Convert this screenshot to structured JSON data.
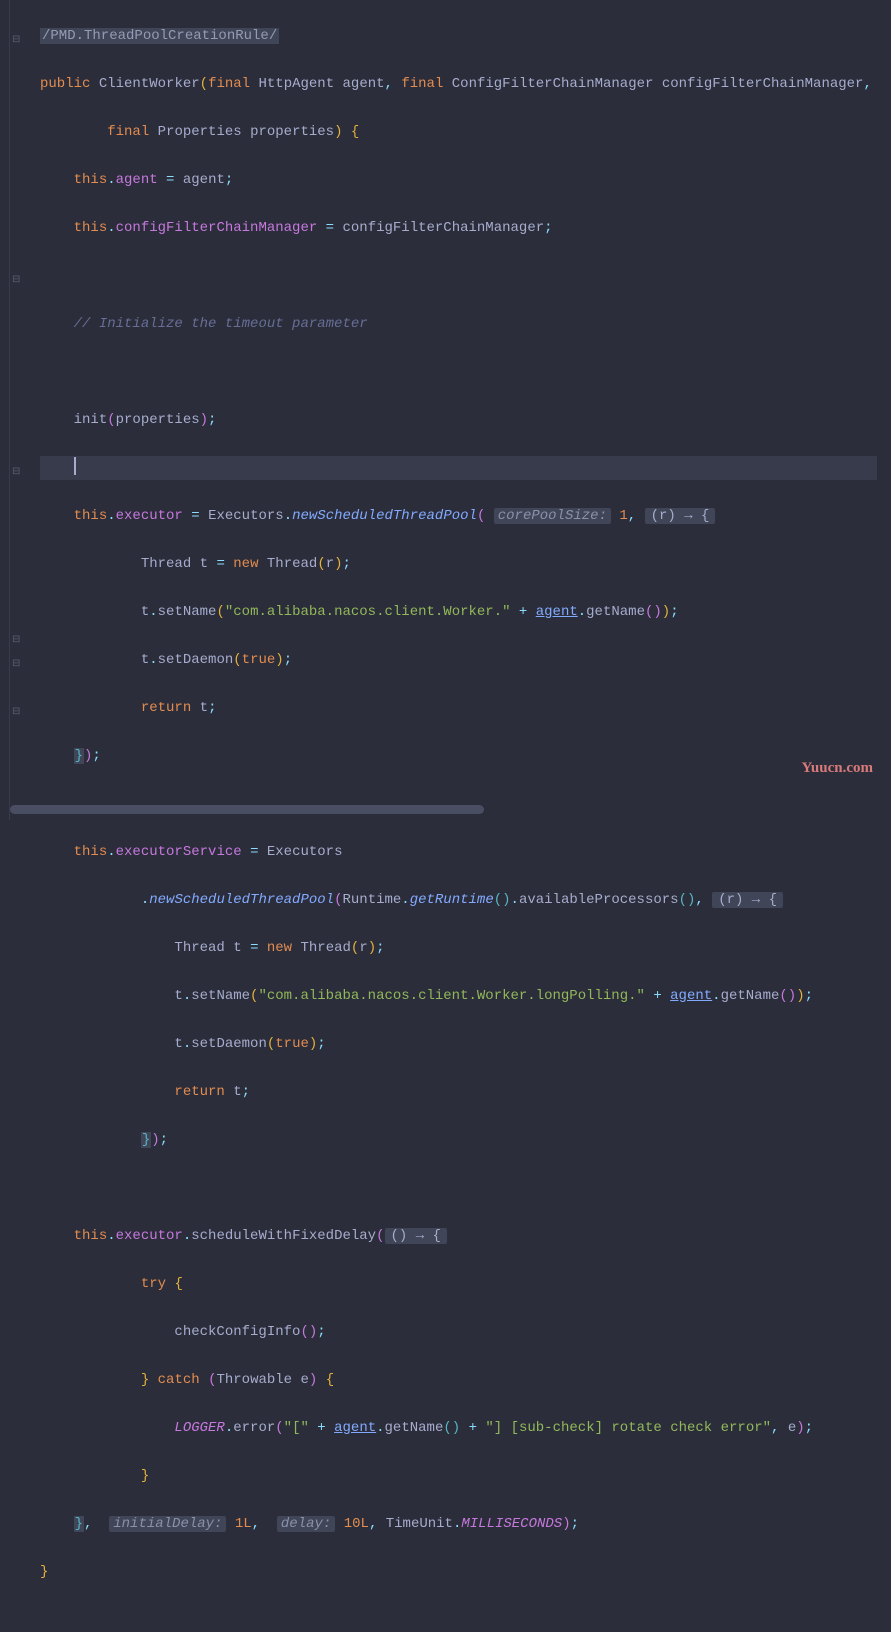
{
  "annotation": "/PMD.ThreadPoolCreationRule/",
  "watermark": "Yuucn.com",
  "t": {
    "public": "public",
    "final": "final",
    "this": "this",
    "new": "new",
    "return": "return",
    "try": "try",
    "catch": "catch",
    "true": "true",
    "ClientWorker": "ClientWorker",
    "HttpAgent": "HttpAgent",
    "agent": "agent",
    "ConfigFilterChainManager": "ConfigFilterChainManager",
    "configFilterChainManager": "configFilterChainManager",
    "Properties": "Properties",
    "properties": "properties",
    "Executors": "Executors",
    "executor": "executor",
    "executorService": "executorService",
    "newScheduledThreadPool": "newScheduledThreadPool",
    "Runtime": "Runtime",
    "getRuntime": "getRuntime",
    "availableProcessors": "availableProcessors",
    "Thread": "Thread",
    "t": "t",
    "r": "r",
    "e": "e",
    "Throwable": "Throwable",
    "setName": "setName",
    "setDaemon": "setDaemon",
    "getName": "getName",
    "scheduleWithFixedDelay": "scheduleWithFixedDelay",
    "checkConfigInfo": "checkConfigInfo",
    "LOGGER": "LOGGER",
    "error": "error",
    "TimeUnit": "TimeUnit",
    "MILLISECONDS": "MILLISECONDS",
    "init": "init",
    "comment1": "// Initialize the timeout parameter",
    "str1": "\"com.alibaba.nacos.client.Worker.\"",
    "str2": "\"com.alibaba.nacos.client.Worker.longPolling.\"",
    "strBracket": "\"[\"",
    "strSubcheck": "\"] [sub-check] rotate check error\"",
    "num1": "1",
    "num1L": "1L",
    "num10L": "10L",
    "corePoolSize": "corePoolSize:",
    "initialDelay": "initialDelay:",
    "delay": "delay:",
    "lambda": "(r) → {",
    "lambda0": "() → {"
  }
}
